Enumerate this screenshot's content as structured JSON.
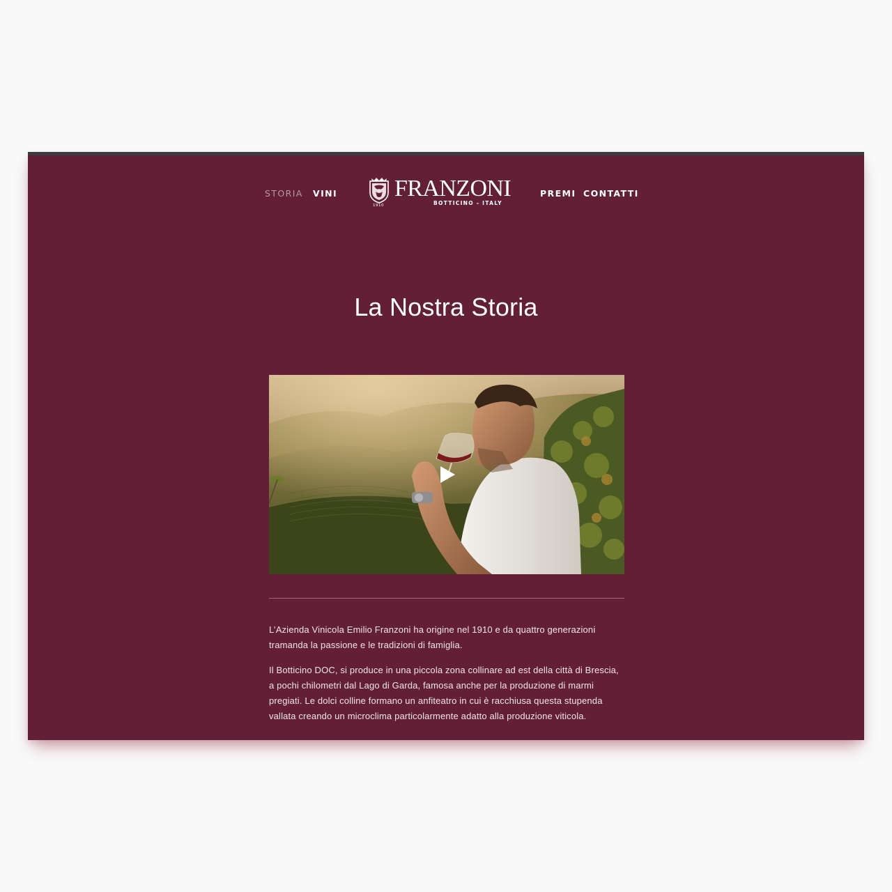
{
  "nav": {
    "left": [
      {
        "label": "STORIA",
        "active": true
      },
      {
        "label": "VINI",
        "active": false
      }
    ],
    "right": [
      {
        "label": "PREMI",
        "active": false
      },
      {
        "label": "CONTATTI",
        "active": false
      }
    ]
  },
  "logo": {
    "brand": "FRANZONI",
    "tagline": "BOTTICINO - ITALY",
    "year": "1910"
  },
  "page": {
    "title": "La Nostra Storia"
  },
  "video": {
    "play_icon": "play-icon"
  },
  "content": {
    "paragraphs": [
      "L’Azienda Vinicola Emilio Franzoni ha origine nel 1910 e da quattro generazioni tramanda la passione e le tradizioni di famiglia.",
      "Il Botticino DOC, si produce in una piccola zona collinare ad est della città di Brescia, a pochi chilometri dal Lago di Garda, famosa anche per la produzione di marmi pregiati. Le dolci colline formano un anfiteatro in cui è racchiusa questa stupenda vallata creando un microclima particolarmente adatto alla produzione viticola."
    ]
  },
  "colors": {
    "background": "#631f36",
    "page": "#f9f9f9",
    "nav_active": "#b79aa3",
    "text": "#ffffff"
  }
}
